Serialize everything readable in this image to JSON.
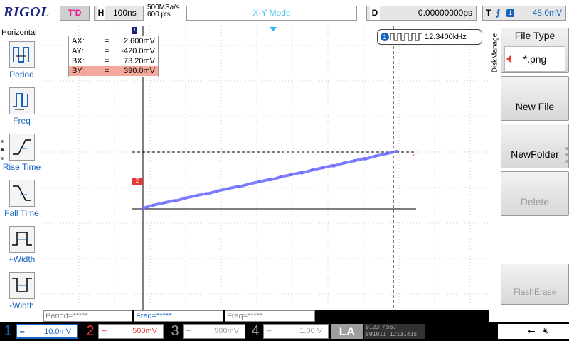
{
  "header": {
    "logo": "RIGOL",
    "trigger_status": "T'D",
    "timebase_label": "H",
    "timebase": "100ns",
    "sample_rate": "500MSa/s",
    "memory_depth": "600 pts",
    "mode": "X-Y Mode",
    "delay_label": "D",
    "delay": "0.00000000ps",
    "trigger_label": "T",
    "trigger_channel": "1",
    "trigger_level": "48.0mV"
  },
  "left_menu": {
    "title": "Horizontal",
    "items": [
      {
        "label": "Period",
        "icon": "period-icon"
      },
      {
        "label": "Freq",
        "icon": "freq-icon"
      },
      {
        "label": "Rise Time",
        "icon": "rise-time-icon"
      },
      {
        "label": "Fall Time",
        "icon": "fall-time-icon"
      },
      {
        "label": "+Width",
        "icon": "pos-width-icon"
      },
      {
        "label": "-Width",
        "icon": "neg-width-icon"
      }
    ]
  },
  "cursors": {
    "ax_label": "AX:",
    "ax": "2.600mV",
    "ay_label": "AY:",
    "ay": "-420.0mV",
    "bx_label": "BX:",
    "bx": "73.20mV",
    "by_label": "BY:",
    "by": "390.0mV",
    "eq": "="
  },
  "freq_counter": {
    "channel": "1",
    "value": "12.3400kHz"
  },
  "markers": {
    "ch1": "1",
    "ch2": "2"
  },
  "measurements": [
    "Period=*****",
    "Freq=*****",
    "Freq=*****"
  ],
  "right_menu": {
    "tab": "DiskManage",
    "file_type_title": "File Type",
    "file_type_value": "*.png",
    "new_file": "New File",
    "new_folder": "NewFolder",
    "delete": "Delete",
    "flash_erase": "FlashErase"
  },
  "channels": [
    {
      "num": "1",
      "scale": "10.0mV",
      "color": "#1565c0"
    },
    {
      "num": "2",
      "scale": "500mV",
      "color": "#e53935"
    },
    {
      "num": "3",
      "scale": "500mV",
      "color": "#9e9e9e"
    },
    {
      "num": "4",
      "scale": "1.00 V",
      "color": "#9e9e9e"
    }
  ],
  "la": {
    "label": "LA",
    "bits_row1": "0123 4567",
    "bits_row2": "891011 12131415"
  },
  "colors": {
    "trace": "#6a6aff",
    "cursor_line": "#000000",
    "brand": "#1a237e"
  }
}
